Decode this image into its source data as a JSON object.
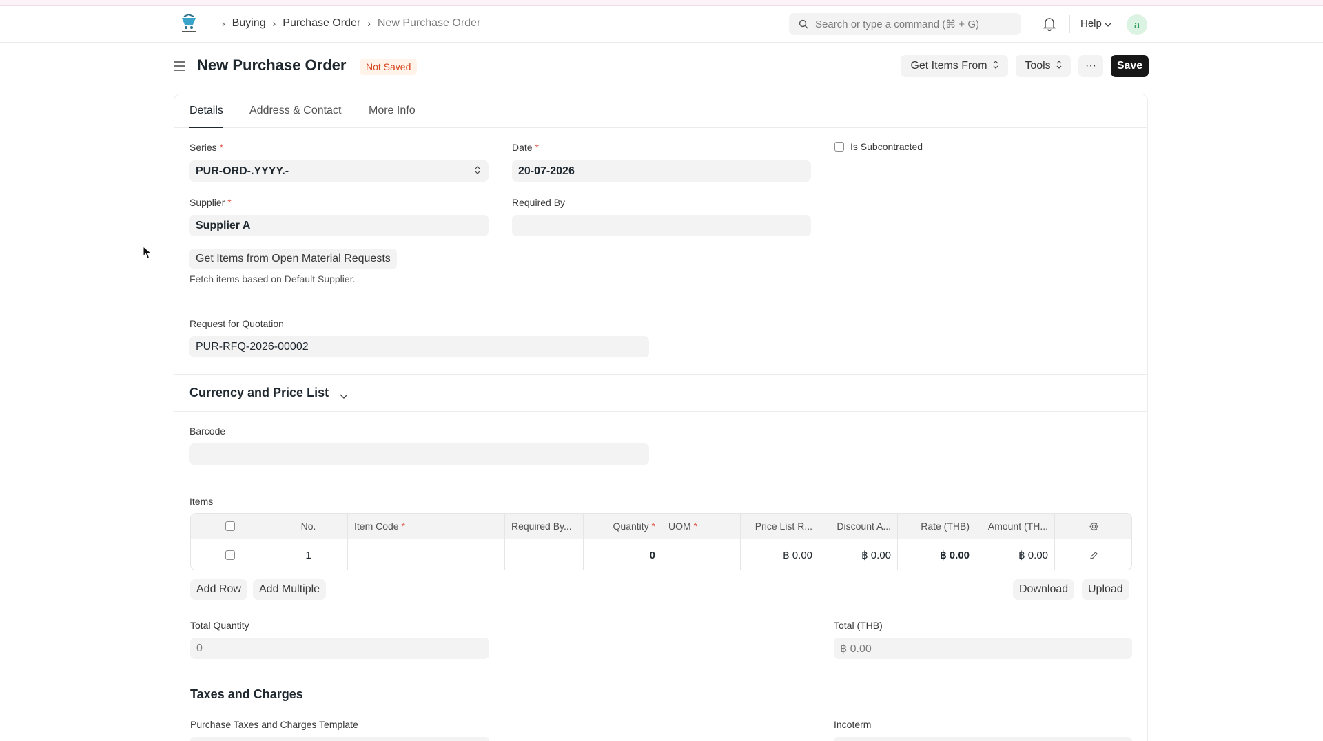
{
  "breadcrumbs": [
    "Buying",
    "Purchase Order",
    "New Purchase Order"
  ],
  "search": {
    "placeholder": "Search or type a command (⌘ + G)"
  },
  "help_label": "Help",
  "avatar_letter": "a",
  "page": {
    "title": "New Purchase Order",
    "status": "Not Saved",
    "get_items_label": "Get Items From",
    "tools_label": "Tools",
    "more_label": "···",
    "save_label": "Save"
  },
  "tabs": [
    "Details",
    "Address & Contact",
    "More Info"
  ],
  "form": {
    "series_label": "Series",
    "series_value": "PUR-ORD-.YYYY.-",
    "date_label": "Date",
    "date_value": "20-07-2026",
    "subcontracted_label": "Is Subcontracted",
    "supplier_label": "Supplier",
    "supplier_value": "Supplier A",
    "required_by_label": "Required By",
    "required_by_value": "",
    "get_open_mr_label": "Get Items from Open Material Requests",
    "fetch_helper": "Fetch items based on Default Supplier.",
    "rfq_label": "Request for Quotation",
    "rfq_value": "PUR-RFQ-2026-00002",
    "currency_section": "Currency and Price List",
    "barcode_label": "Barcode",
    "barcode_value": "",
    "items_label": "Items"
  },
  "items_table": {
    "headers": [
      "No.",
      "Item Code",
      "Required By...",
      "Quantity",
      "UOM",
      "Price List R...",
      "Discount A...",
      "Rate (THB)",
      "Amount (TH..."
    ],
    "rows": [
      {
        "no": "1",
        "item_code": "",
        "required_by": "",
        "quantity": "0",
        "uom": "",
        "price_list_rate": "฿ 0.00",
        "discount_amount": "฿ 0.00",
        "rate": "฿ 0.00",
        "amount": "฿ 0.00"
      }
    ],
    "add_row_label": "Add Row",
    "add_multiple_label": "Add Multiple",
    "download_label": "Download",
    "upload_label": "Upload"
  },
  "totals": {
    "total_quantity_label": "Total Quantity",
    "total_quantity_value": "0",
    "total_label": "Total (THB)",
    "total_value": "฿ 0.00"
  },
  "taxes": {
    "section_title": "Taxes and Charges",
    "template_label": "Purchase Taxes and Charges Template",
    "incoterm_label": "Incoterm"
  },
  "colors": {
    "primary_button": "#171717",
    "status_badge_bg": "#fff3ea",
    "status_badge_text": "#d6461f",
    "required_marker": "#e2584b",
    "field_bg": "#f3f3f3"
  },
  "icons": [
    "logo-icon",
    "chevron-right-icon",
    "search-icon",
    "bell-icon",
    "chevron-down-icon",
    "hamburger-icon",
    "updown-icon",
    "gear-icon",
    "edit-icon",
    "cursor-icon"
  ]
}
